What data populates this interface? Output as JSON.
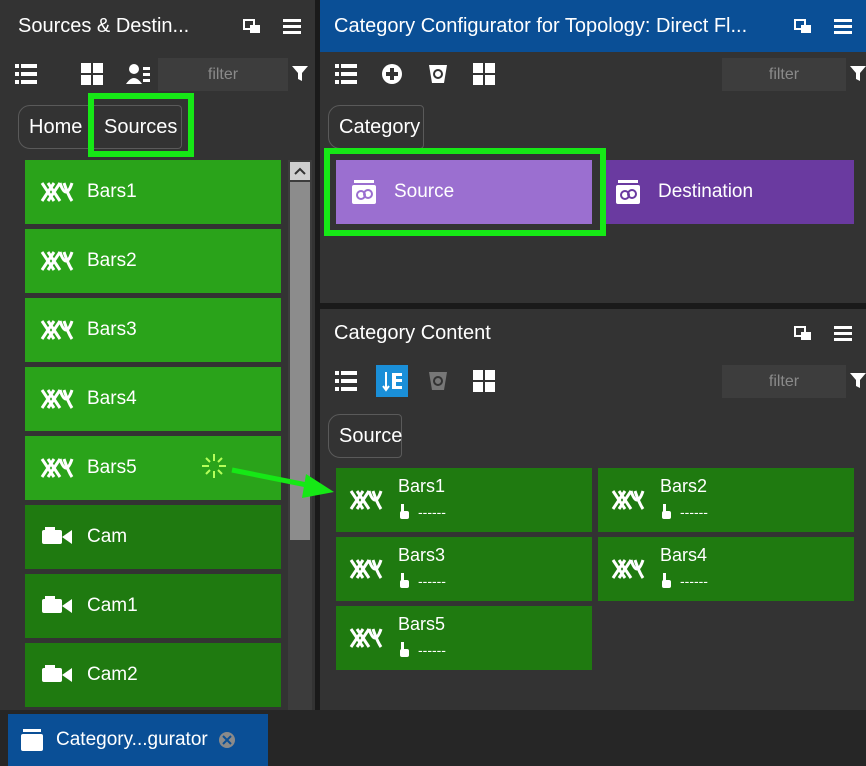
{
  "left_panel": {
    "title": "Sources & Destin...",
    "filter_placeholder": "filter",
    "breadcrumb": [
      "Home",
      "Sources"
    ],
    "items": [
      {
        "label": "Bars1",
        "icon": "test-pattern-icon",
        "selected": true
      },
      {
        "label": "Bars2",
        "icon": "test-pattern-icon",
        "selected": true
      },
      {
        "label": "Bars3",
        "icon": "test-pattern-icon",
        "selected": true
      },
      {
        "label": "Bars4",
        "icon": "test-pattern-icon",
        "selected": true
      },
      {
        "label": "Bars5",
        "icon": "test-pattern-icon",
        "selected": true
      },
      {
        "label": "Cam",
        "icon": "camera-icon",
        "selected": false
      },
      {
        "label": "Cam1",
        "icon": "camera-icon",
        "selected": false
      },
      {
        "label": "Cam2",
        "icon": "camera-icon",
        "selected": false
      }
    ]
  },
  "configurator": {
    "title": "Category Configurator for Topology: Direct Fl...",
    "filter_placeholder": "filter",
    "breadcrumb": "Category",
    "categories": [
      {
        "label": "Source",
        "color": "#9b6fd0"
      },
      {
        "label": "Destination",
        "color": "#6a3aa0"
      }
    ]
  },
  "content": {
    "title": "Category Content",
    "filter_placeholder": "filter",
    "breadcrumb": "Source",
    "tiles": [
      {
        "name": "Bars1",
        "sub": "------"
      },
      {
        "name": "Bars2",
        "sub": "------"
      },
      {
        "name": "Bars3",
        "sub": "------"
      },
      {
        "name": "Bars4",
        "sub": "------"
      },
      {
        "name": "Bars5",
        "sub": "------"
      }
    ]
  },
  "taskbar": {
    "tab_label": "Category...gurator"
  },
  "colors": {
    "highlight": "#16e816",
    "selected_green": "#2aa31a",
    "unselected_green": "#1f7a10",
    "header_blue": "#0a4f96"
  }
}
